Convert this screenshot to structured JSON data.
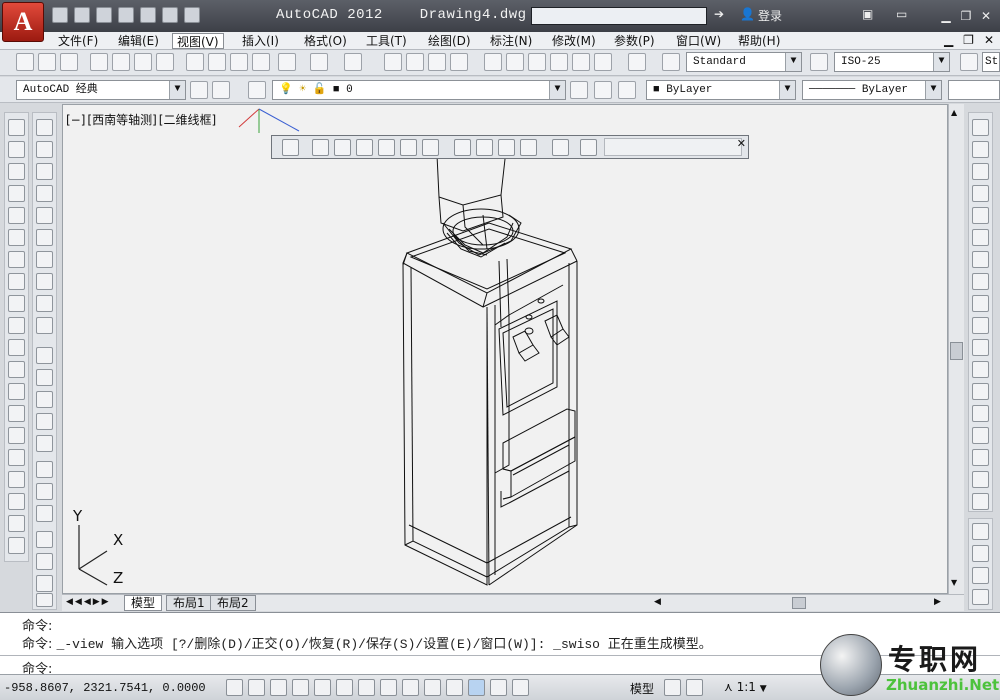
{
  "titlebar": {
    "app_logo": "A",
    "app_name": "AutoCAD 2012",
    "document": "Drawing4.dwg",
    "login": "登录"
  },
  "menu": [
    "文件(F)",
    "编辑(E)",
    "视图(V)",
    "插入(I)",
    "格式(O)",
    "工具(T)",
    "绘图(D)",
    "标注(N)",
    "修改(M)",
    "参数(P)",
    "窗口(W)",
    "帮助(H)"
  ],
  "menu_active_index": 2,
  "styles": {
    "text_style": "Standard",
    "dim_style": "ISO-25",
    "table_style_partial": "St"
  },
  "workspace": "AutoCAD 经典",
  "layer": {
    "current": "0",
    "color": "ByLayer",
    "linetype": "ByLayer"
  },
  "viewport": {
    "label_parts": [
      "[−]",
      "[西南等轴测]",
      "[二维线框]"
    ]
  },
  "ucs_axes": {
    "x": "X",
    "y": "Y",
    "z": "Z"
  },
  "layout_tabs": [
    "模型",
    "布局1",
    "布局2"
  ],
  "command": {
    "line1": "命令:",
    "line2_prefix": "命令:",
    "line2_text": "_-view 输入选项 [?/删除(D)/正交(O)/恢复(R)/保存(S)/设置(E)/窗口(W)]: _swiso 正在重生成模型。",
    "prompt": "命令:"
  },
  "statusbar": {
    "coords": "-958.8607, 2321.7541, 0.0000",
    "space": "模型",
    "annotation_scale": "1:1"
  },
  "watermark": {
    "cn": "专职网",
    "en": "Zhuanzhi.Net"
  }
}
